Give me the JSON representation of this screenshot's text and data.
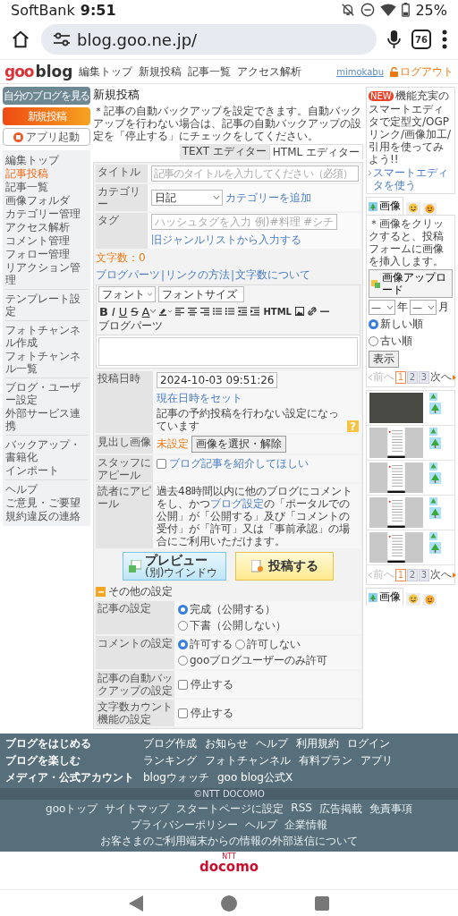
{
  "status_bar": {
    "carrier": "SoftBank",
    "time": "9:51",
    "battery": "25%"
  },
  "browser": {
    "url": "blog.goo.ne.jp/",
    "tab_count": "76"
  },
  "header": {
    "logo": {
      "brand": "goo",
      "product": "blog"
    },
    "nav": [
      "編集トップ",
      "新規投稿",
      "記事一覧",
      "アクセス解析"
    ],
    "username": "mimokabu",
    "logout": "ログアウト"
  },
  "sidebar": {
    "view_blog": "自分のブログを見る",
    "new_post": "新規投稿",
    "app_launch": "アプリ起動",
    "groups": [
      {
        "items": [
          {
            "label": "編集トップ",
            "selected": false
          },
          {
            "label": "記事投稿",
            "selected": true
          },
          {
            "label": "記事一覧",
            "selected": false
          },
          {
            "label": "画像フォルダ",
            "selected": false
          },
          {
            "label": "カテゴリー管理",
            "selected": false
          },
          {
            "label": "アクセス解析",
            "selected": false
          },
          {
            "label": "コメント管理",
            "selected": false
          },
          {
            "label": "フォロー管理",
            "selected": false
          },
          {
            "label": "リアクション管理",
            "selected": false
          }
        ]
      },
      {
        "items": [
          {
            "label": "テンプレート設定",
            "selected": false
          }
        ]
      },
      {
        "items": [
          {
            "label": "フォトチャンネル作成",
            "selected": false
          },
          {
            "label": "フォトチャンネル一覧",
            "selected": false
          }
        ]
      },
      {
        "items": [
          {
            "label": "ブログ・ユーザー設定",
            "selected": false
          },
          {
            "label": "外部サービス連携",
            "selected": false
          }
        ]
      },
      {
        "items": [
          {
            "label": "バックアップ・書籍化",
            "selected": false
          },
          {
            "label": "インポート",
            "selected": false
          }
        ]
      },
      {
        "items": [
          {
            "label": "ヘルプ",
            "selected": false
          },
          {
            "label": "ご意見・ご要望",
            "selected": false
          },
          {
            "label": "規約違反の連絡",
            "selected": false
          }
        ]
      }
    ]
  },
  "main": {
    "title": "新規投稿",
    "notice": "＊記事の自動バックアップを設定できます。自動バックアップを行わない場合は、記事の自動バックアップの設定を「停止する」にチェックをしてください。",
    "editor_tabs": [
      {
        "label": "TEXT エディター",
        "selected": false
      },
      {
        "label": "HTML エディター",
        "selected": true
      }
    ],
    "form": {
      "title_label": "タイトル",
      "title_placeholder": "記事のタイトルを入力してください（必須）",
      "category_label": "カテゴリー",
      "category_value": "日記",
      "add_category": "カテゴリーを追加",
      "tag_label": "タグ",
      "tag_placeholder": "ハッシュタグを入力 例)#料理 #シチ",
      "genre_link": "旧ジャンルリストから入力する"
    },
    "char_count": "文字数：0",
    "help_links": [
      "ブログパーツ",
      "リンクの方法",
      "文字数について"
    ],
    "link_separator": "|",
    "font_select": "フォント",
    "size_select": "フォントサイズ",
    "toolbar": [
      {
        "kind": "bold",
        "label": "B"
      },
      {
        "kind": "italic",
        "label": "I"
      },
      {
        "kind": "underline",
        "label": "U"
      },
      {
        "kind": "strike",
        "label": "S"
      },
      {
        "kind": "color",
        "label": "A"
      },
      {
        "kind": "highlight"
      },
      {
        "kind": "align-left"
      },
      {
        "kind": "align-center"
      },
      {
        "kind": "align-right"
      },
      {
        "kind": "bullets"
      },
      {
        "kind": "numbers"
      },
      {
        "kind": "outdent"
      },
      {
        "kind": "indent"
      },
      {
        "kind": "html",
        "label": "HTML"
      },
      {
        "kind": "image"
      },
      {
        "kind": "link"
      },
      {
        "kind": "rule"
      },
      {
        "kind": "parts",
        "label": "ブログパーツ"
      }
    ],
    "post_date": {
      "label": "投稿日時",
      "value": "2024-10-03 09:51:26",
      "set_now": "現在日時をセット",
      "note": "記事の予約投稿を行わない設定になっています",
      "help_mark": "?"
    },
    "headline_image": {
      "label": "見出し画像",
      "status": "未設定",
      "button": "画像を選択・解除"
    },
    "staff_appeal": {
      "label": "スタッフにアピール",
      "checked": false,
      "link": "ブログ記事を紹介してほしい"
    },
    "reader_appeal": {
      "label": "読者にアピール",
      "text_before": "過去48時間以内に他のブログにコメントをし、かつ",
      "link": "ブログ設定",
      "text_after": "の「ポータルでの公開」が「公開する」及び「コメントの受付」が「許可」又は「事前承認」の場合にご利用いただけます。"
    },
    "preview_button": {
      "label": "プレビュー",
      "sub": "(別)ウインドウ"
    },
    "post_button": "投稿する",
    "other_settings": {
      "label": "その他の設定",
      "expanded": true,
      "rows": [
        {
          "kind": "radio",
          "label": "記事の設定",
          "options": [
            {
              "label": "完成（公開する）",
              "selected": true
            },
            {
              "label": "下書（公開しない）",
              "selected": false
            }
          ]
        },
        {
          "kind": "radio",
          "label": "コメントの設定",
          "options": [
            {
              "label": "許可する",
              "selected": true
            },
            {
              "label": "許可しない",
              "selected": false
            },
            {
              "label": "gooブログユーザーのみ許可",
              "selected": false
            }
          ]
        },
        {
          "kind": "checkbox",
          "label": "記事の自動バックアップの設定",
          "option": "停止する",
          "checked": false
        },
        {
          "kind": "checkbox",
          "label": "文字数カウント機能の設定",
          "option": "停止する",
          "checked": false
        }
      ]
    }
  },
  "right": {
    "promo": {
      "badge": "NEW",
      "text": "機能充実のスマートエディタで定型文/OGPリンク/画像加工/引用を使ってみよう!!",
      "link": "スマートエディタを使う"
    },
    "tabs": [
      {
        "kind": "image",
        "label": "画像",
        "selected": true
      },
      {
        "kind": "emoji",
        "selected": false
      },
      {
        "kind": "face",
        "selected": false
      }
    ],
    "note": "＊画像をクリックすると、投稿フォームに画像を挿入します。",
    "upload": "画像アップロード",
    "year": {
      "value": "—",
      "unit": "年"
    },
    "month": {
      "value": "—",
      "unit": "月"
    },
    "order": [
      {
        "label": "新しい順",
        "selected": true
      },
      {
        "label": "古い順",
        "selected": false
      }
    ],
    "show": "表示",
    "pager": {
      "prev": "前へ",
      "prev_disabled": true,
      "pages": [
        {
          "label": "1",
          "selected": true
        },
        {
          "label": "2",
          "selected": false
        },
        {
          "label": "3",
          "selected": false
        }
      ],
      "next": "次へ"
    },
    "images": [
      {
        "kind": "photo"
      },
      {
        "kind": "screenshot"
      },
      {
        "kind": "screenshot"
      },
      {
        "kind": "screenshot"
      },
      {
        "kind": "screenshot"
      }
    ],
    "bottom_pager": {
      "prev": "前へ",
      "prev_disabled": true,
      "pages": [
        {
          "label": "1",
          "selected": true
        },
        {
          "label": "2",
          "selected": false
        },
        {
          "label": "3",
          "selected": false
        }
      ],
      "next": "次へ"
    },
    "bottom_tabs": [
      {
        "kind": "image",
        "label": "画像",
        "selected": true
      },
      {
        "kind": "emoji",
        "selected": false
      },
      {
        "kind": "face",
        "selected": false
      }
    ]
  },
  "footer": {
    "rows": [
      {
        "heading": "ブログをはじめる",
        "links": [
          "ブログ作成",
          "お知らせ",
          "ヘルプ",
          "利用規約",
          "ログイン"
        ]
      },
      {
        "heading": "ブログを楽しむ",
        "links": [
          "ランキング",
          "フォトチャンネル",
          "有料プラン",
          "アプリ"
        ]
      },
      {
        "heading": "メディア・公式アカウント",
        "links": [
          "blogウォッチ",
          "goo blog公式X"
        ]
      }
    ],
    "copyright": "©NTT DOCOMO",
    "links": [
      "gooトップ",
      "サイトマップ",
      "スタートページに設定",
      "RSS",
      "広告掲載",
      "免責事項",
      "プライバシーポリシー",
      "ヘルプ",
      "企業情報"
    ],
    "notice_link": "お客さまのご利用端末からの情報の外部送信について",
    "brand": {
      "small": "NTT",
      "name": "docomo"
    }
  }
}
